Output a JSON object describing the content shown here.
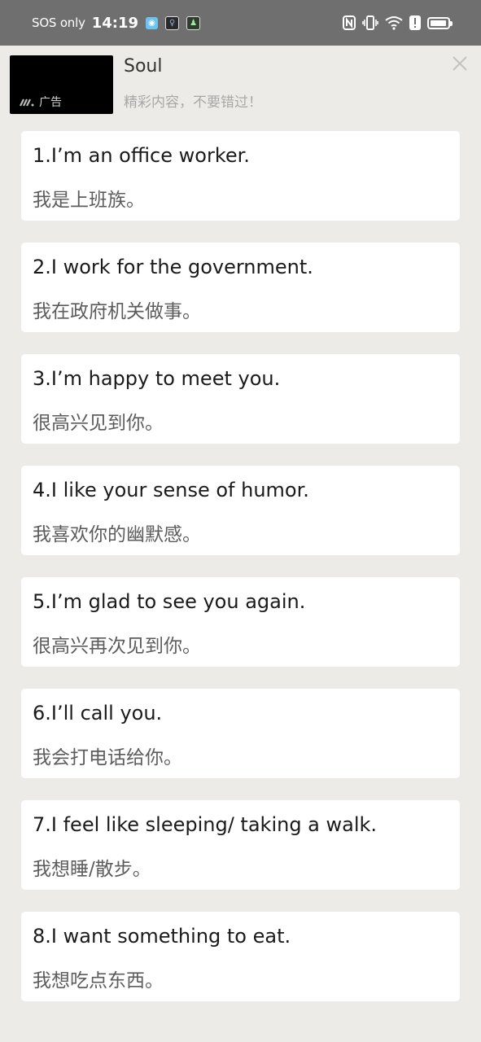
{
  "status_bar": {
    "carrier": "SOS only",
    "time": "14:19",
    "icons": [
      "app-notification-icon",
      "app-notification-icon",
      "app-notification-icon",
      "nfc-icon",
      "vibrate-icon",
      "wifi-icon",
      "alert-icon",
      "battery-icon"
    ],
    "battery_level_fraction": 0.95
  },
  "ad": {
    "badge": "广告",
    "title": "Soul",
    "subtitle": "精彩内容，不要错过！",
    "close_icon": "close-icon"
  },
  "phrases": [
    {
      "en": "1.I’m an office worker.",
      "zh": "我是上班族。"
    },
    {
      "en": "2.I work for the government.",
      "zh": "我在政府机关做事。"
    },
    {
      "en": "3.I’m happy to meet you.",
      "zh": "很高兴见到你。"
    },
    {
      "en": "4.I like your sense of humor.",
      "zh": "我喜欢你的幽默感。"
    },
    {
      "en": "5.I’m glad to see you again.",
      "zh": "很高兴再次见到你。"
    },
    {
      "en": "6.I’ll call you.",
      "zh": "我会打电话给你。"
    },
    {
      "en": "7.I feel like sleeping/ taking a walk.",
      "zh": "我想睡/散步。"
    },
    {
      "en": "8.I want something to eat.",
      "zh": "我想吃点东西。"
    }
  ]
}
